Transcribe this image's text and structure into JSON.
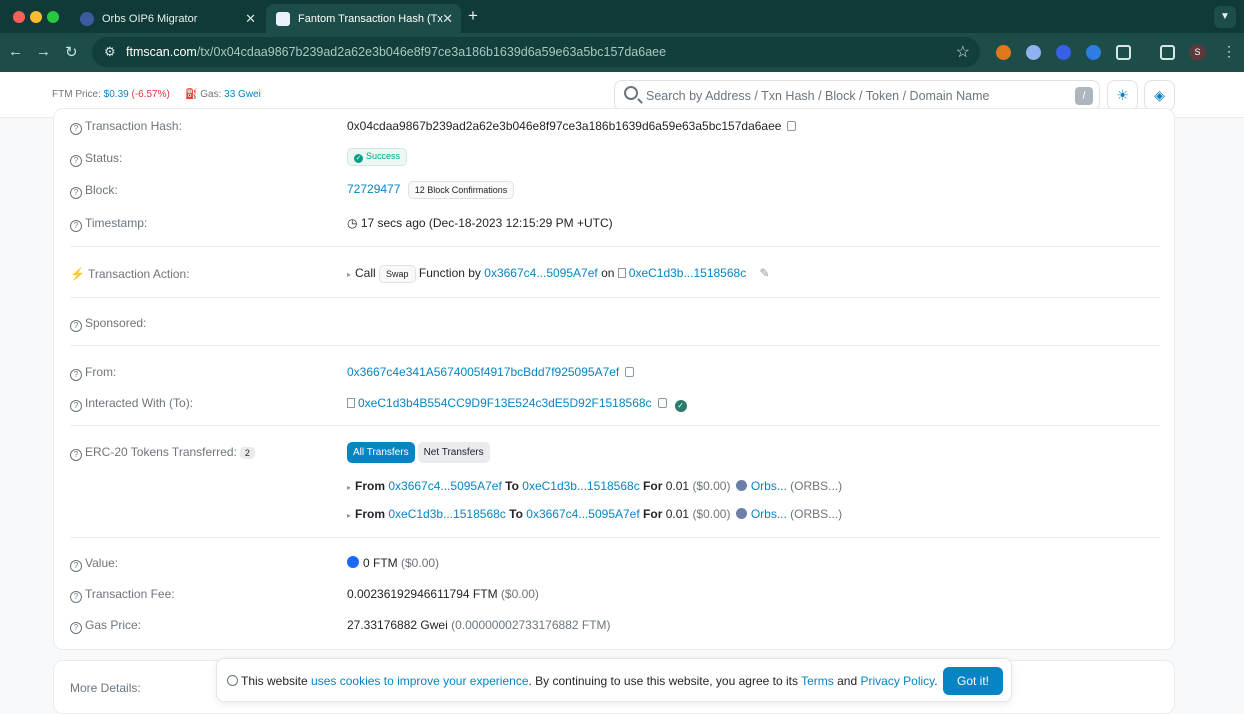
{
  "browser": {
    "tabs": [
      {
        "title": "Orbs OIP6 Migrator",
        "active": false
      },
      {
        "title": "Fantom Transaction Hash (Tx",
        "active": true
      }
    ],
    "new_tab": "+",
    "url_host": "ftmscan.com",
    "url_path": "/tx/0x04cdaa9867b239ad2a62e3b046e8f97ce3a186b1639d6a59e63a5bc157da6aee",
    "profile_initial": "S",
    "colors": {
      "chrome": "#0f3a37",
      "toolbar": "#1c4d48"
    }
  },
  "header": {
    "ftm_price_label": "FTM Price:",
    "ftm_price": "$0.39",
    "ftm_change": "(-6.57%)",
    "gas_label": "Gas:",
    "gas_value": "33 Gwei",
    "search_placeholder": "Search by Address / Txn Hash / Block / Token / Domain Name",
    "search_shortcut": "/"
  },
  "tx": {
    "hash_label": "Transaction Hash:",
    "hash": "0x04cdaa9867b239ad2a62e3b046e8f97ce3a186b1639d6a59e63a5bc157da6aee",
    "status_label": "Status:",
    "status": "Success",
    "block_label": "Block:",
    "block": "72729477",
    "confirmations": "12 Block Confirmations",
    "timestamp_label": "Timestamp:",
    "timestamp": "17 secs ago (Dec-18-2023 12:15:29 PM +UTC)",
    "action_label": "Transaction Action:",
    "action_call": "Call",
    "action_method": "Swap",
    "action_function_by": "Function by",
    "action_by": "0x3667c4...5095A7ef",
    "action_on": "on",
    "action_contract": "0xeC1d3b...1518568c",
    "sponsored_label": "Sponsored:",
    "from_label": "From:",
    "from": "0x3667c4e341A5674005f4917bcBdd7f925095A7ef",
    "to_label": "Interacted With (To):",
    "to": "0xeC1d3b4B554CC9D9F13E524c3dE5D92F1518568c",
    "erc20_label": "ERC-20 Tokens Transferred:",
    "erc20_count": "2",
    "tab_all": "All Transfers",
    "tab_net": "Net Transfers",
    "transfers": [
      {
        "from_kw": "From",
        "from": "0x3667c4...5095A7ef",
        "to_kw": "To",
        "to": "0xeC1d3b...1518568c",
        "for_kw": "For",
        "amount": "0.01",
        "usd": "($0.00)",
        "token": "Orbs...",
        "symbol": "(ORBS...)"
      },
      {
        "from_kw": "From",
        "from": "0xeC1d3b...1518568c",
        "to_kw": "To",
        "to": "0x3667c4...5095A7ef",
        "for_kw": "For",
        "amount": "0.01",
        "usd": "($0.00)",
        "token": "Orbs...",
        "symbol": "(ORBS...)"
      }
    ],
    "value_label": "Value:",
    "value": "0 FTM",
    "value_usd": "($0.00)",
    "fee_label": "Transaction Fee:",
    "fee": "0.00236192946611794 FTM",
    "fee_usd": "($0.00)",
    "gas_price_label": "Gas Price:",
    "gas_price": "27.33176882 Gwei",
    "gas_price_ftm": "(0.00000002733176882 FTM)"
  },
  "more_details": "More Details:",
  "cookie": {
    "prefix": "This website",
    "link1": "uses cookies to improve your experience",
    "middle": ". By continuing to use this website, you agree to its",
    "terms": "Terms",
    "and": "and",
    "privacy": "Privacy Policy",
    "end": ".",
    "button": "Got it!"
  },
  "colors": {
    "link": "#0784c3",
    "success": "#00a186",
    "negative": "#dc3545"
  }
}
